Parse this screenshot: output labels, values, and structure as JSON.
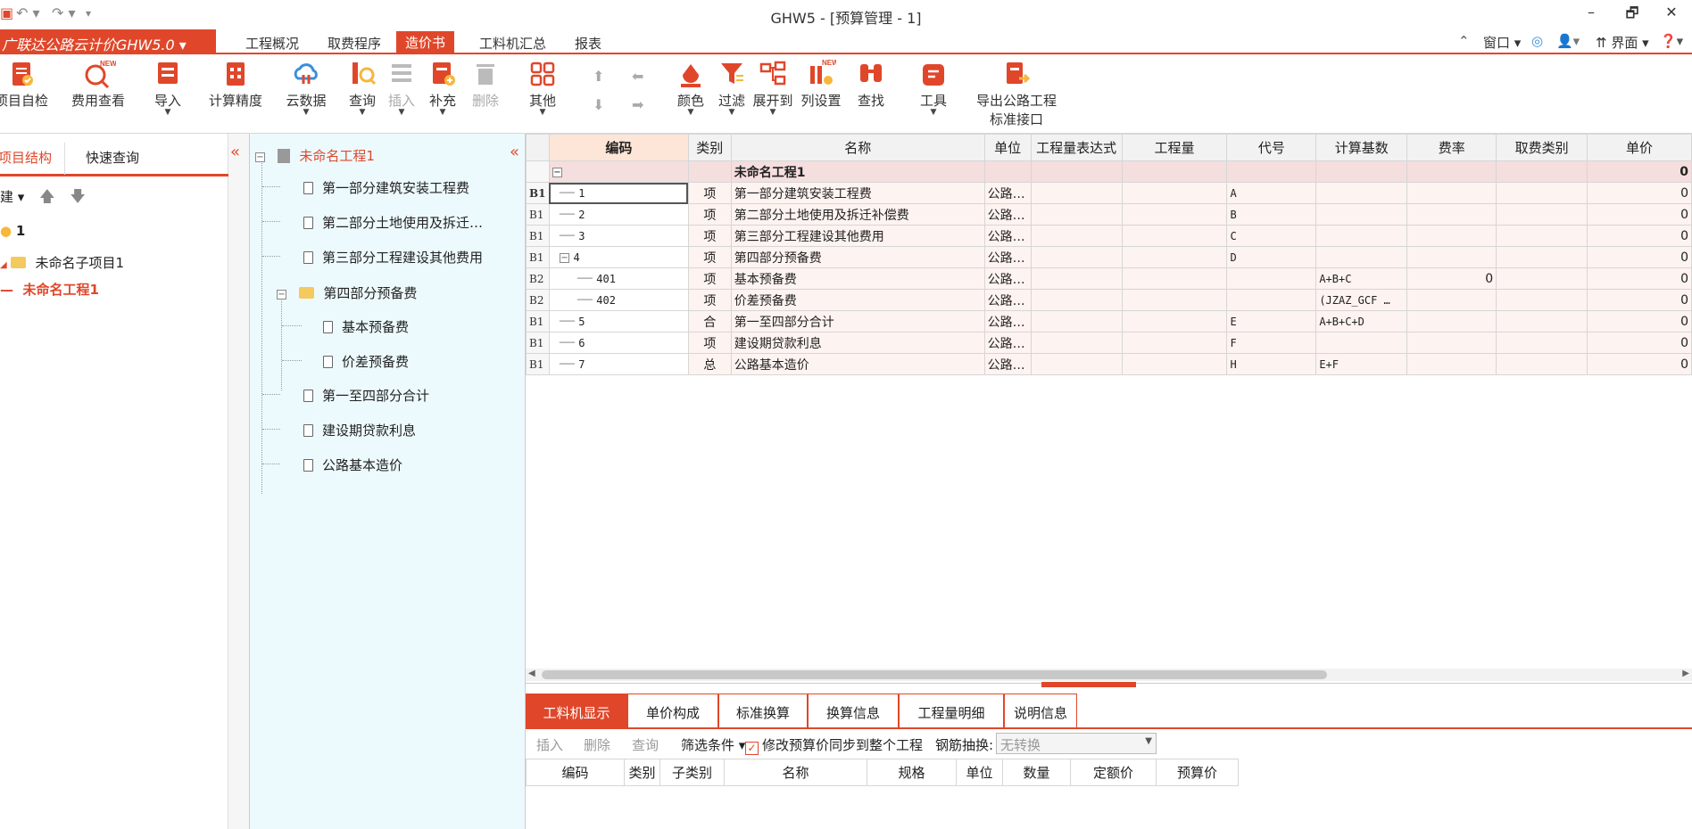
{
  "window": {
    "title": "GHW5 - [预算管理 - 1]",
    "controls": [
      "–",
      "🗗",
      "✕"
    ]
  },
  "menubar": {
    "product": "广联达公路云计价GHW5.0 ▾",
    "tabs": [
      "工程概况",
      "取费程序",
      "造价书",
      "工料机汇总",
      "报表"
    ],
    "active_tab": "造价书",
    "right_items": [
      "窗口 ▾",
      "界面 ▾"
    ]
  },
  "ribbon": {
    "buttons": [
      {
        "label": "项目自检",
        "icon": "check-doc-icon"
      },
      {
        "label": "费用查看",
        "icon": "fee-view-icon",
        "badge": "NEW"
      },
      {
        "label": "导入",
        "icon": "import-icon"
      },
      {
        "label": "计算精度",
        "icon": "precision-icon"
      },
      {
        "label": "云数据",
        "icon": "cloud-data-icon"
      },
      {
        "label": "查询",
        "icon": "query-icon"
      },
      {
        "label": "插入",
        "icon": "insert-icon"
      },
      {
        "label": "补充",
        "icon": "supplement-icon"
      },
      {
        "label": "删除",
        "icon": "delete-icon"
      },
      {
        "label": "其他",
        "icon": "other-icon"
      },
      {
        "label": "颜色",
        "icon": "color-icon"
      },
      {
        "label": "过滤",
        "icon": "filter-icon"
      },
      {
        "label": "展开到",
        "icon": "expand-icon"
      },
      {
        "label": "列设置",
        "icon": "column-settings-icon",
        "badge": "NEW"
      },
      {
        "label": "查找",
        "icon": "find-icon"
      },
      {
        "label": "工具",
        "icon": "tools-icon"
      },
      {
        "label": "导出公路工程",
        "label2": "标准接口",
        "icon": "export-icon"
      }
    ]
  },
  "project_panel": {
    "tabs": [
      "项目结构",
      "快速查询"
    ],
    "active_tab": "项目结构",
    "tool_label": "建 ▾",
    "nodes": [
      {
        "label": "1",
        "type": "root"
      },
      {
        "label": "未命名子项目1",
        "type": "folder"
      },
      {
        "label": "未命名工程1",
        "type": "selected"
      }
    ]
  },
  "tree": {
    "root": "未命名工程1",
    "items": [
      {
        "label": "第一部分建筑安装工程费",
        "depth": 1
      },
      {
        "label": "第二部分土地使用及拆迁…",
        "depth": 1
      },
      {
        "label": "第三部分工程建设其他费用",
        "depth": 1
      },
      {
        "label": "第四部分预备费",
        "depth": 1,
        "folder": true
      },
      {
        "label": "基本预备费",
        "depth": 2
      },
      {
        "label": "价差预备费",
        "depth": 2
      },
      {
        "label": "第一至四部分合计",
        "depth": 1
      },
      {
        "label": "建设期贷款利息",
        "depth": 1
      },
      {
        "label": "公路基本造价",
        "depth": 1
      }
    ]
  },
  "grid": {
    "columns": [
      "编码",
      "类别",
      "名称",
      "单位",
      "工程量表达式",
      "工程量",
      "代号",
      "计算基数",
      "费率",
      "取费类别",
      "单价"
    ],
    "root_row": {
      "name": "未命名工程1",
      "price": "0"
    },
    "rows": [
      {
        "level": "B1",
        "code": "1",
        "type": "项",
        "name": "第一部分建筑安装工程费",
        "unit": "公路…",
        "alias": "A",
        "base": "",
        "rate": "",
        "price": "0",
        "indent": 1
      },
      {
        "level": "B1",
        "code": "2",
        "type": "项",
        "name": "第二部分土地使用及拆迁补偿费",
        "unit": "公路…",
        "alias": "B",
        "base": "",
        "rate": "",
        "price": "0",
        "indent": 1
      },
      {
        "level": "B1",
        "code": "3",
        "type": "项",
        "name": "第三部分工程建设其他费用",
        "unit": "公路…",
        "alias": "C",
        "base": "",
        "rate": "",
        "price": "0",
        "indent": 1
      },
      {
        "level": "B1",
        "code": "4",
        "type": "项",
        "name": "第四部分预备费",
        "unit": "公路…",
        "alias": "D",
        "base": "",
        "rate": "",
        "price": "0",
        "indent": 1,
        "expander": true
      },
      {
        "level": "B2",
        "code": "401",
        "type": "项",
        "name": "基本预备费",
        "unit": "公路…",
        "alias": "",
        "base": "A+B+C",
        "rate": "0",
        "price": "0",
        "indent": 2
      },
      {
        "level": "B2",
        "code": "402",
        "type": "项",
        "name": "价差预备费",
        "unit": "公路…",
        "alias": "",
        "base": "(JZAZ_GCF …",
        "rate": "",
        "price": "0",
        "indent": 2
      },
      {
        "level": "B1",
        "code": "5",
        "type": "合",
        "name": "第一至四部分合计",
        "unit": "公路…",
        "alias": "E",
        "base": "A+B+C+D",
        "rate": "",
        "price": "0",
        "indent": 1
      },
      {
        "level": "B1",
        "code": "6",
        "type": "项",
        "name": "建设期贷款利息",
        "unit": "公路…",
        "alias": "F",
        "base": "",
        "rate": "",
        "price": "0",
        "indent": 1
      },
      {
        "level": "B1",
        "code": "7",
        "type": "总",
        "name": "公路基本造价",
        "unit": "公路…",
        "alias": "H",
        "base": "E+F",
        "rate": "",
        "price": "0",
        "indent": 1
      }
    ]
  },
  "bottom": {
    "tabs": [
      "工料机显示",
      "单价构成",
      "标准换算",
      "换算信息",
      "工程量明细",
      "说明信息"
    ],
    "active_tab": "工料机显示",
    "tools": {
      "insert": "插入",
      "delete": "删除",
      "query": "查询",
      "filter": "筛选条件 ▾",
      "sync_label": "修改预算价同步到整个工程",
      "rebar_label": "钢筋抽换:",
      "rebar_value": "无转换"
    },
    "columns": [
      "编码",
      "类别",
      "子类别",
      "名称",
      "规格",
      "单位",
      "数量",
      "定额价",
      "预算价"
    ]
  },
  "colors": {
    "accent": "#e0472a",
    "tree_bg": "#edfafd"
  }
}
